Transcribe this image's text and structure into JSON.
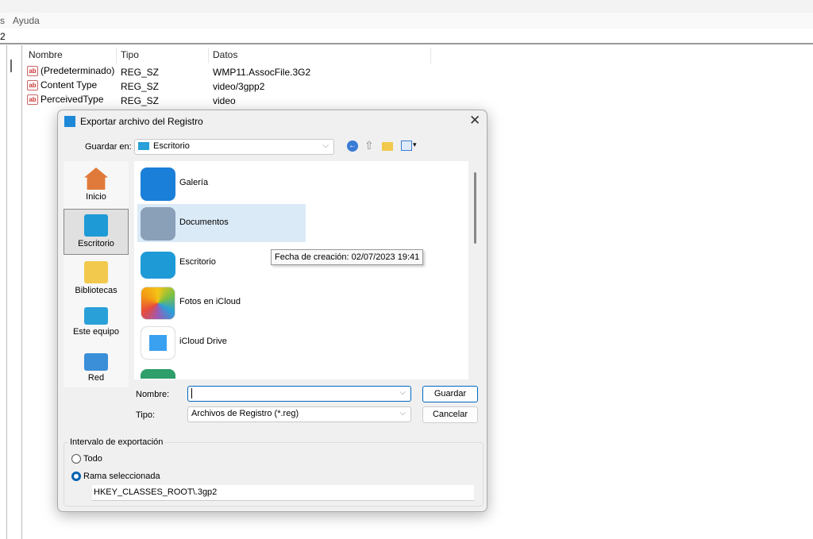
{
  "menu": {
    "partial": "s",
    "help": "Ayuda"
  },
  "address": {
    "value": "2"
  },
  "list": {
    "columns": [
      "Nombre",
      "Tipo",
      "Datos"
    ],
    "rows": [
      {
        "name": "(Predeterminado)",
        "type": "REG_SZ",
        "data": "WMP11.AssocFile.3G2"
      },
      {
        "name": "Content Type",
        "type": "REG_SZ",
        "data": "video/3gpp2"
      },
      {
        "name": "PerceivedType",
        "type": "REG_SZ",
        "data": "video"
      }
    ],
    "icon": "ab"
  },
  "dialog": {
    "title": "Exportar archivo del Registro",
    "save_in_label": "Guardar en:",
    "save_in_value": "Escritorio",
    "places": [
      {
        "label": "Inicio"
      },
      {
        "label": "Escritorio"
      },
      {
        "label": "Bibliotecas"
      },
      {
        "label": "Este equipo"
      },
      {
        "label": "Red"
      }
    ],
    "files": [
      {
        "name": "Galería"
      },
      {
        "name": "Documentos"
      },
      {
        "name": "Escritorio"
      },
      {
        "name": "Fotos en iCloud"
      },
      {
        "name": "iCloud Drive"
      }
    ],
    "tooltip": "Fecha de creación: 02/07/2023 19:41",
    "name_label": "Nombre:",
    "name_value": "",
    "type_label": "Tipo:",
    "type_value": "Archivos de Registro (*.reg)",
    "save_button": "Guardar",
    "cancel_button": "Cancelar",
    "range": {
      "legend": "Intervalo de exportación",
      "all": "Todo",
      "selected": "Rama seleccionada",
      "selected_checked": true,
      "branch": "HKEY_CLASSES_ROOT\\.3gp2"
    },
    "accent": "#0063b1"
  }
}
